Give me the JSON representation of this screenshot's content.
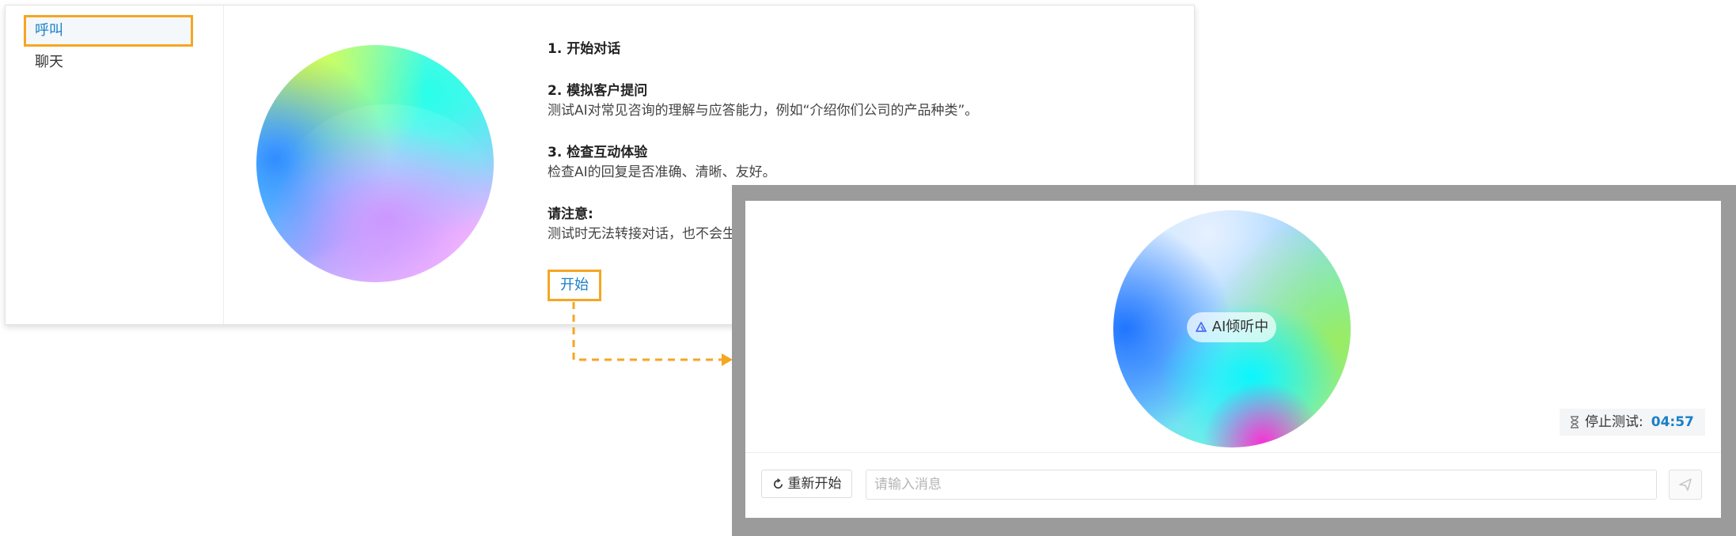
{
  "sidebar": {
    "items": [
      {
        "label": "呼叫",
        "active": true
      },
      {
        "label": "聊天",
        "active": false
      }
    ]
  },
  "steps": [
    {
      "title": "1. 开始对话",
      "body": ""
    },
    {
      "title": "2. 模拟客户提问",
      "body": "测试AI对常见咨询的理解与应答能力，例如“介绍你们公司的产品种类”。"
    },
    {
      "title": "3. 检查互动体验",
      "body": "检查AI的回复是否准确、清晰、友好。"
    },
    {
      "title": "请注意:",
      "body": "测试时无法转接对话，也不会生成"
    }
  ],
  "start_button": "开始",
  "test_panel": {
    "status_label": "AI倾听中",
    "stop_label": "停止测试:",
    "timer": "04:57",
    "restart_label": "重新开始",
    "input_placeholder": "请输入消息"
  },
  "colors": {
    "accent": "#1a7fc8",
    "highlight_border": "#f5a623",
    "overlay_frame": "#9b9b9b"
  }
}
